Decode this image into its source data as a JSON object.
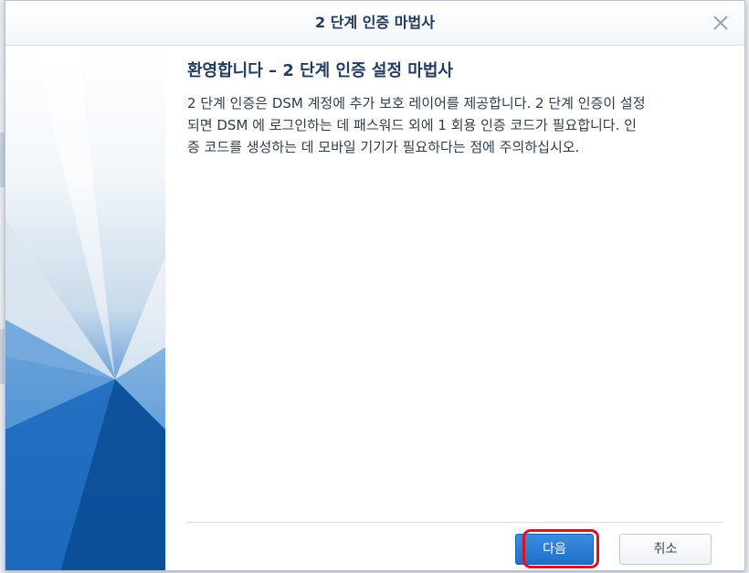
{
  "dialog": {
    "title": "2 단계 인증 마법사",
    "close_icon": "close-icon"
  },
  "content": {
    "heading": "환영합니다 – 2 단계 인증 설정 마법사",
    "description_lines": [
      "2 단계 인증은 DSM 계정에 추가 보호 레이어를 제공합니다. 2 단계 인증이 설정",
      "되면 DSM 에 로그인하는 데 패스워드 외에 1 회용 인증 코드가 필요합니다. 인",
      "증 코드를 생성하는 데 모바일 기기가 필요하다는 점에 주의하십시오."
    ]
  },
  "footer": {
    "next_label": "다음",
    "cancel_label": "취소"
  },
  "colors": {
    "accent": "#2277d4",
    "highlight": "#e2101d",
    "side_dark": "#0a4f9e",
    "side_light": "#e6eef6"
  }
}
